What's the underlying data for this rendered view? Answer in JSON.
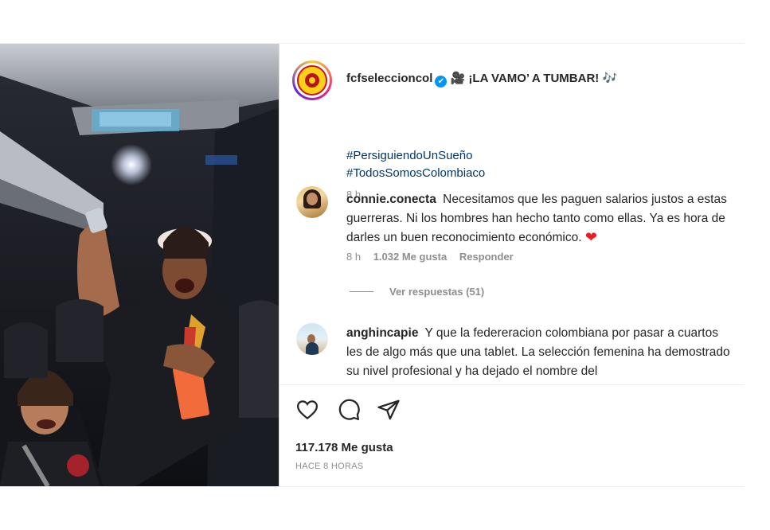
{
  "post": {
    "author": "fcfseleccioncol",
    "caption_prefix_emoji": "🎥",
    "caption_title": "¡LA VAMO’ A TUMBAR!",
    "caption_suffix_emoji": "🎶",
    "hashtags": [
      "#PersiguiendoUnSueño",
      "#TodosSomosColombiaco"
    ],
    "time_ago": "8 h"
  },
  "comments": [
    {
      "username": "connie.conecta",
      "text": "Necesitamos que les paguen salarios justos a estas guerreras. Ni los hombres han hecho tanto como ellas. Ya es hora de darles un buen reconocimiento económico.",
      "emoji": "❤",
      "time": "8 h",
      "likes": "1.032 Me gusta",
      "reply_label": "Responder",
      "view_replies": "Ver respuestas (51)"
    },
    {
      "username": "anghincapie",
      "text": "Y que la federeracion colombiana por pasar a cuartos les de algo más que una tablet. La selección femenina ha demostrado su nivel profesional y ha dejado el nombre del"
    }
  ],
  "actions": {
    "like_icon": "heart-icon",
    "comment_icon": "comment-icon",
    "share_icon": "send-icon"
  },
  "likes_count": "117.178 Me gusta",
  "timestamp": "HACE 8 HORAS"
}
